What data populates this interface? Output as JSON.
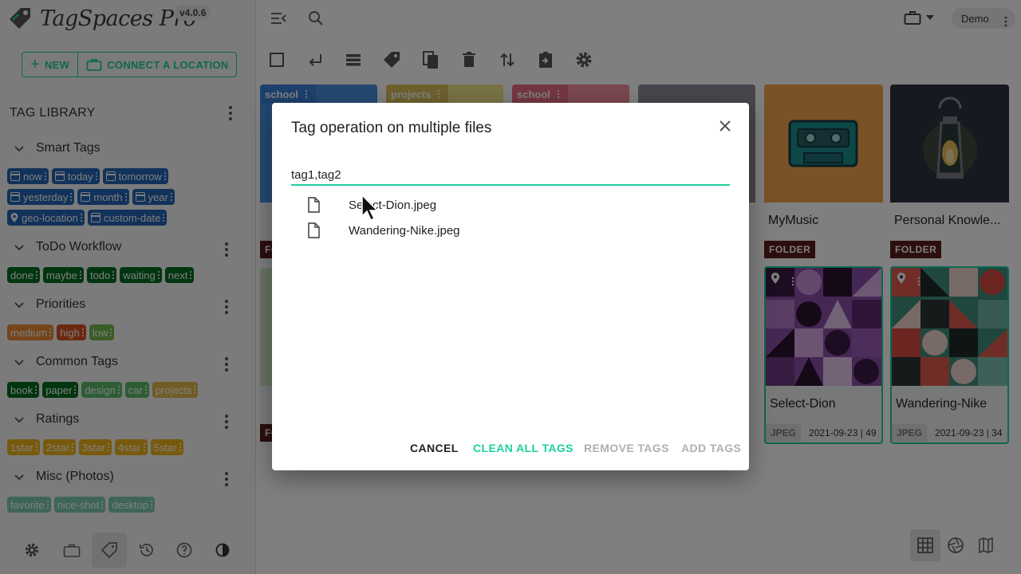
{
  "app": {
    "name": "TagSpaces Pro",
    "version": "v4.0.6"
  },
  "sidebar": {
    "new_label": "NEW",
    "connect_label": "CONNECT A LOCATION",
    "tag_library_title": "TAG LIBRARY",
    "groups": [
      {
        "name": "Smart Tags",
        "color": "#2264b5",
        "tags": [
          "now",
          "today",
          "tomorrow",
          "yesterday",
          "month",
          "year",
          "geo-location",
          "custom-date"
        ]
      },
      {
        "name": "ToDo Workflow",
        "color": "#006d1f",
        "tags": [
          "done",
          "maybe",
          "todo",
          "waiting",
          "next"
        ]
      },
      {
        "name": "Priorities",
        "tags": [
          "medium",
          "high",
          "low"
        ],
        "colors": [
          "#e98b34",
          "#d8511f",
          "#75b84a"
        ]
      },
      {
        "name": "Common Tags",
        "tags": [
          "book",
          "paper",
          "design",
          "car",
          "projects"
        ],
        "colors": [
          "#006d1f",
          "#006d1f",
          "#5cbb6b",
          "#5cbb6b",
          "#e2b94c"
        ]
      },
      {
        "name": "Ratings",
        "color": "#f0b51b",
        "tags": [
          "1star",
          "2star",
          "3star",
          "4star",
          "5star"
        ]
      },
      {
        "name": "Misc (Photos)",
        "color": "#7dcbb3",
        "tags": [
          "favorite",
          "nice-shot",
          "desktop"
        ]
      }
    ]
  },
  "topbar": {
    "user_label": "Demo"
  },
  "cards": {
    "c1_tag": "school",
    "c2_tag": "projects",
    "c3_tag": "school",
    "mymusic": {
      "title": "MyMusic",
      "badge": "FOLDER"
    },
    "personal": {
      "title": "Personal Knowle...",
      "badge": "FOLDER"
    },
    "select_dion": {
      "title": "Select-Dion",
      "type": "JPEG",
      "meta": "2021-09-23 | 49"
    },
    "wandering_nike": {
      "title": "Wandering-Nike",
      "type": "JPEG",
      "meta": "2021-09-23 | 34"
    }
  },
  "dialog": {
    "title": "Tag operation on multiple files",
    "input_value": "tag1,tag2",
    "files": [
      "Select-Dion.jpeg",
      "Wandering-Nike.jpeg"
    ],
    "buttons": {
      "cancel": "CANCEL",
      "clean_all": "CLEAN ALL TAGS",
      "remove": "REMOVE TAGS",
      "add": "ADD TAGS"
    }
  },
  "colors": {
    "accent": "#1dd19f",
    "folder_badge": "#5b1d1d",
    "overlay": "rgba(0,0,0,0.5)"
  }
}
